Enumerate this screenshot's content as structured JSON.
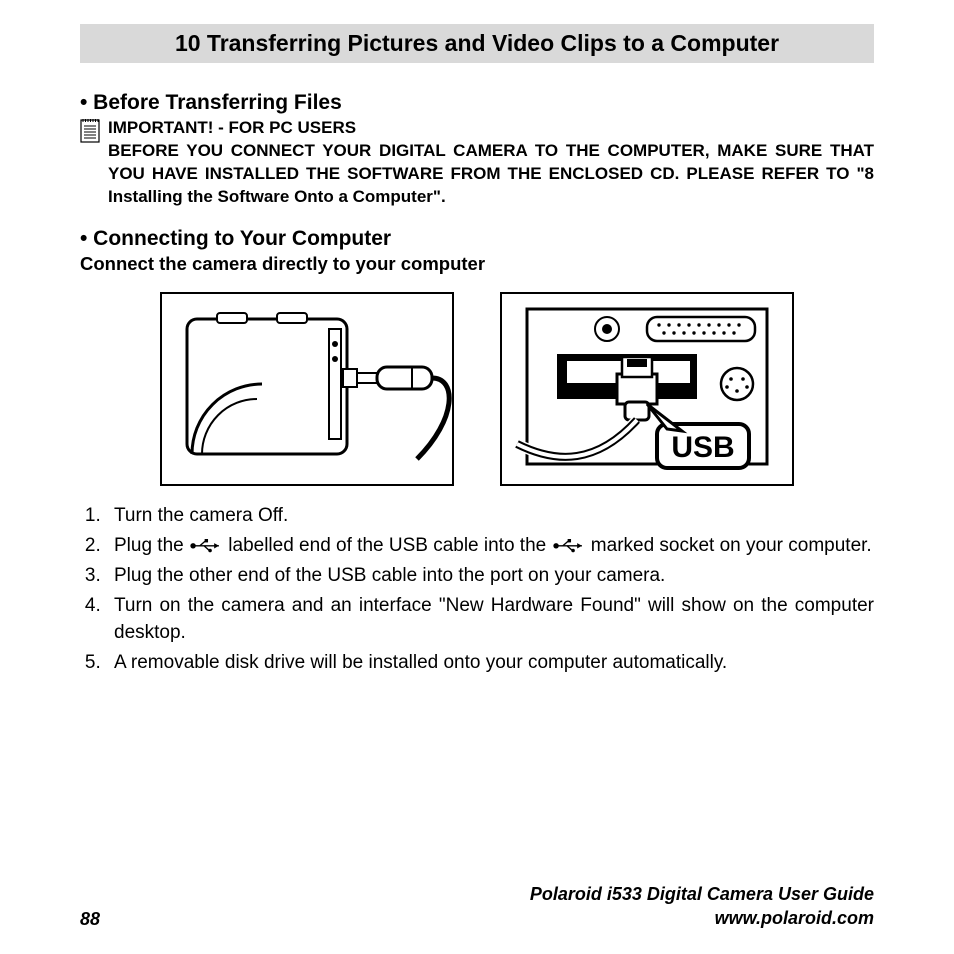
{
  "chapterTitle": "10 Transferring Pictures and Video Clips to a Computer",
  "section1": {
    "heading": "• Before Transferring Files",
    "importantLabel": "IMPORTANT! - FOR PC USERS",
    "importantBody": "BEFORE YOU CONNECT YOUR DIGITAL CAMERA TO THE COMPUTER, MAKE SURE THAT YOU HAVE INSTALLED THE SOFTWARE FROM THE ENCLOSED CD. PLEASE REFER TO \"8 Installing the Software Onto a Computer\"."
  },
  "section2": {
    "heading": "• Connecting to Your Computer",
    "subHeading": "Connect the camera directly to your computer",
    "usbLabel": "USB",
    "steps": {
      "s1": "Turn the camera Off.",
      "s2a": "Plug the ",
      "s2b": " labelled end of the USB cable into the ",
      "s2c": " marked socket on your computer.",
      "s3": "Plug the other end of the USB cable into the port on your camera.",
      "s4": "Turn on the camera and an interface \"New Hardware Found\" will show on the computer desktop.",
      "s5": "A removable disk drive will be installed onto your computer automatically."
    }
  },
  "footer": {
    "pageNumber": "88",
    "guideTitle": "Polaroid i533 Digital Camera User Guide",
    "url": "www.polaroid.com"
  }
}
